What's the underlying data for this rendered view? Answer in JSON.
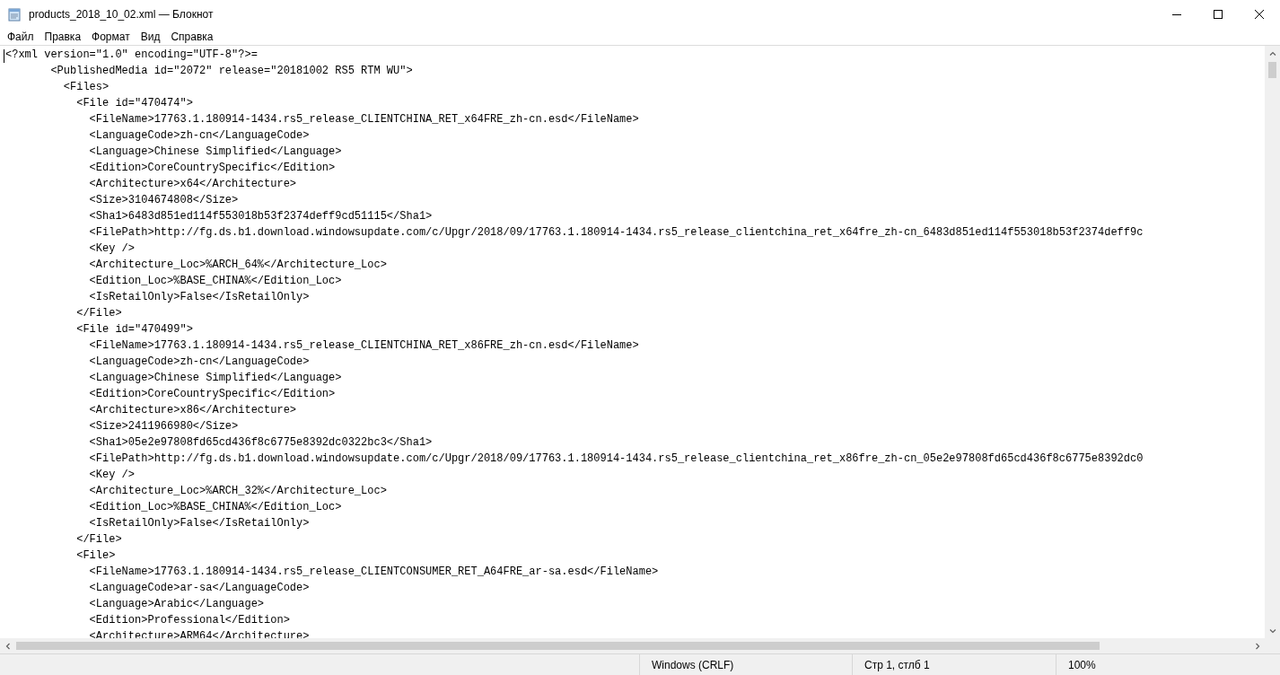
{
  "window": {
    "title": "products_2018_10_02.xml — Блокнот"
  },
  "menu": [
    "Файл",
    "Правка",
    "Формат",
    "Вид",
    "Справка"
  ],
  "editor": {
    "lines": [
      "<?xml version=\"1.0\" encoding=\"UTF-8\"?>=",
      "       <PublishedMedia id=\"2072\" release=\"20181002 RS5 RTM WU\">",
      "         <Files>",
      "           <File id=\"470474\">",
      "             <FileName>17763.1.180914-1434.rs5_release_CLIENTCHINA_RET_x64FRE_zh-cn.esd</FileName>",
      "             <LanguageCode>zh-cn</LanguageCode>",
      "             <Language>Chinese Simplified</Language>",
      "             <Edition>CoreCountrySpecific</Edition>",
      "             <Architecture>x64</Architecture>",
      "             <Size>3104674808</Size>",
      "             <Sha1>6483d851ed114f553018b53f2374deff9cd51115</Sha1>",
      "             <FilePath>http://fg.ds.b1.download.windowsupdate.com/c/Upgr/2018/09/17763.1.180914-1434.rs5_release_clientchina_ret_x64fre_zh-cn_6483d851ed114f553018b53f2374deff9c",
      "             <Key />",
      "             <Architecture_Loc>%ARCH_64%</Architecture_Loc>",
      "             <Edition_Loc>%BASE_CHINA%</Edition_Loc>",
      "             <IsRetailOnly>False</IsRetailOnly>",
      "           </File>",
      "           <File id=\"470499\">",
      "             <FileName>17763.1.180914-1434.rs5_release_CLIENTCHINA_RET_x86FRE_zh-cn.esd</FileName>",
      "             <LanguageCode>zh-cn</LanguageCode>",
      "             <Language>Chinese Simplified</Language>",
      "             <Edition>CoreCountrySpecific</Edition>",
      "             <Architecture>x86</Architecture>",
      "             <Size>2411966980</Size>",
      "             <Sha1>05e2e97808fd65cd436f8c6775e8392dc0322bc3</Sha1>",
      "             <FilePath>http://fg.ds.b1.download.windowsupdate.com/c/Upgr/2018/09/17763.1.180914-1434.rs5_release_clientchina_ret_x86fre_zh-cn_05e2e97808fd65cd436f8c6775e8392dc0",
      "             <Key />",
      "             <Architecture_Loc>%ARCH_32%</Architecture_Loc>",
      "             <Edition_Loc>%BASE_CHINA%</Edition_Loc>",
      "             <IsRetailOnly>False</IsRetailOnly>",
      "           </File>",
      "           <File>",
      "             <FileName>17763.1.180914-1434.rs5_release_CLIENTCONSUMER_RET_A64FRE_ar-sa.esd</FileName>",
      "             <LanguageCode>ar-sa</LanguageCode>",
      "             <Language>Arabic</Language>",
      "             <Edition>Professional</Edition>",
      "             <Architecture>ARM64</Architecture>"
    ]
  },
  "status_bar": {
    "line_endings": "Windows (CRLF)",
    "position": "Стр 1, стлб 1",
    "zoom": "100%"
  }
}
